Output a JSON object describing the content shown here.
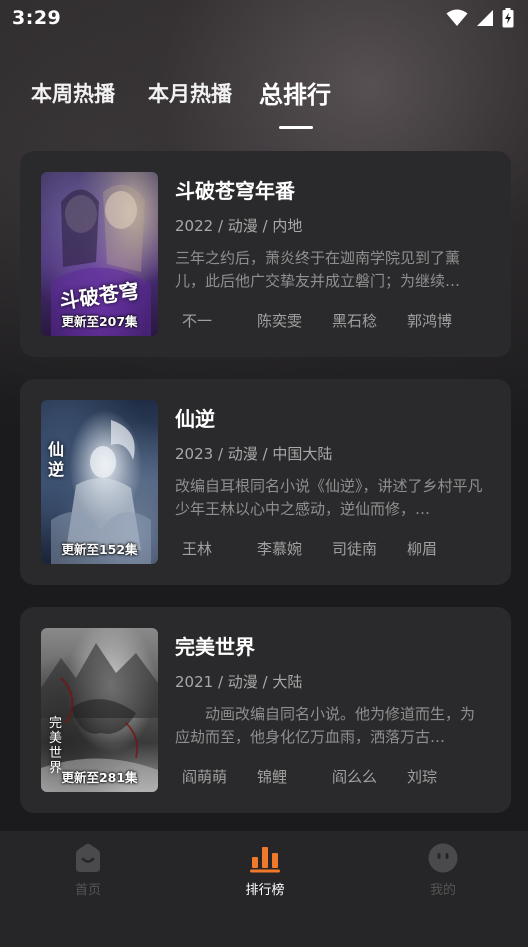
{
  "status": {
    "time": "3:29"
  },
  "tabs": [
    {
      "label": "本周热播"
    },
    {
      "label": "本月热播"
    },
    {
      "label": "总排行"
    }
  ],
  "active_tab": 2,
  "items": [
    {
      "title": "斗破苍穹年番",
      "meta": "2022 / 动漫 / 内地",
      "desc": "三年之约后，萧炎终于在迦南学院见到了薰儿，此后他广交挚友并成立磐门；为继续…",
      "update": "更新至207集",
      "poster_art": "斗破苍穹",
      "cast": [
        "不一",
        "陈奕雯",
        "黑石稔",
        "郭鸿博"
      ]
    },
    {
      "title": "仙逆",
      "meta": "2023 / 动漫 / 中国大陆",
      "desc": "改编自耳根同名小说《仙逆》，讲述了乡村平凡少年王林以心中之感动，逆仙而修，…",
      "update": "更新至152集",
      "poster_art": "仙逆",
      "cast": [
        "王林",
        "李慕婉",
        "司徒南",
        "柳眉"
      ]
    },
    {
      "title": "完美世界",
      "meta": "2021 / 动漫 / 大陆",
      "desc": "　　动画改编自同名小说。他为修道而生，为应劫而至，他身化亿万血雨，洒落万古…",
      "update": "更新至281集",
      "poster_art": "完美世界",
      "cast": [
        "阎萌萌",
        "锦鲤",
        "阎么么",
        "刘琮"
      ]
    }
  ],
  "nav": [
    {
      "label": "首页",
      "icon": "home-icon"
    },
    {
      "label": "排行榜",
      "icon": "ranking-icon"
    },
    {
      "label": "我的",
      "icon": "profile-icon"
    }
  ],
  "colors": {
    "accent": "#f07a2a",
    "card": "#2a2a2c",
    "background": "#1b1b1d"
  }
}
